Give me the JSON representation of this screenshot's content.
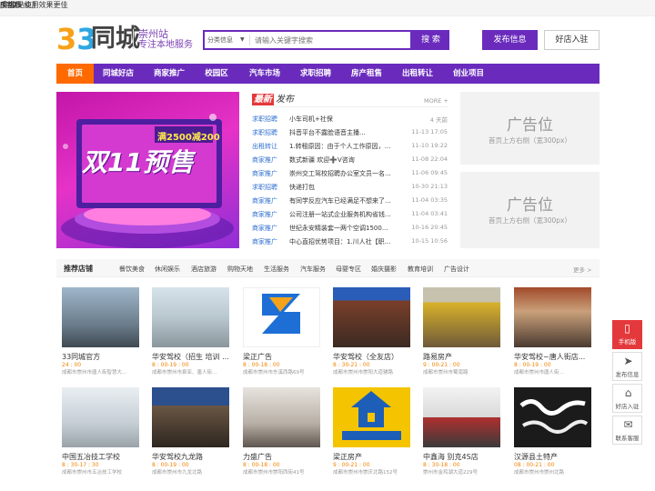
{
  "topbar": {
    "city": "成都市",
    "switch": "[切换站点]",
    "right": "手机版 使用效果更佳"
  },
  "header": {
    "logo_num": "33",
    "logo_text": "同城",
    "site_name": "崇州站",
    "slogan": "专注本地服务",
    "search_category": "分类信息",
    "search_placeholder": "请输入关键字搜索",
    "search_button": "搜 索",
    "post_button": "发布信息",
    "shop_button": "好店入驻"
  },
  "nav": [
    "首页",
    "同城好店",
    "商家推广",
    "校园区",
    "汽车市场",
    "求职招聘",
    "房产租售",
    "出租转让",
    "创业项目"
  ],
  "banner": {
    "line1": "双11预售",
    "badge": "满2500减200"
  },
  "news": {
    "tag": "最新",
    "title": "发布",
    "more": "MORE +",
    "items": [
      {
        "cat": "求职招聘",
        "text": "小车司机+社保",
        "time": "4 天前"
      },
      {
        "cat": "求职招聘",
        "text": "抖音平台不露脸语音主播...",
        "time": "11-13 17:05"
      },
      {
        "cat": "出租转让",
        "text": "1.转租原因：由于个人工作原因，...",
        "time": "11-10 19:22"
      },
      {
        "cat": "商家推广",
        "text": "数式新疆 欢迎➕V咨询",
        "time": "11-08 22:04"
      },
      {
        "cat": "商家推广",
        "text": "崇州交工驾校招聘办公室文员一名...",
        "time": "11-06 09:45"
      },
      {
        "cat": "求职招聘",
        "text": "快递打包",
        "time": "10-30 21:13"
      },
      {
        "cat": "商家推广",
        "text": "有同学反应汽车已经满足不想来了...",
        "time": "11-04 03:35"
      },
      {
        "cat": "商家推广",
        "text": "公司注册一站式企业服务机构省钱...",
        "time": "11-04 03:41"
      },
      {
        "cat": "商家推广",
        "text": "世纪永安精装套一两个空调1500...",
        "time": "10-16 20:45"
      },
      {
        "cat": "商家推广",
        "text": "中心直招优势项目：1.川人社【职...",
        "time": "10-15 10:56"
      }
    ]
  },
  "ads": [
    {
      "title": "广告位",
      "sub": "首页上方右侧（宽300px）"
    },
    {
      "title": "广告位",
      "sub": "首页上方右侧（宽300px）"
    }
  ],
  "shops": {
    "title": "推荐店铺",
    "more": "更多 >",
    "categories": [
      "餐饮美食",
      "休闲娱乐",
      "酒店旅游",
      "购物天地",
      "生活服务",
      "汽车服务",
      "母婴专区",
      "婚庆摄影",
      "教育培训",
      "广告设计"
    ],
    "row1": [
      {
        "name": "33同城官方",
        "time": "24 : 00",
        "addr": "成都市崇州市唐人街智慧大..."
      },
      {
        "name": "华安驾校（招生 培训 ...",
        "time": "8 : 00-19 : 00",
        "addr": "成都市崇州市泉亚、唐人街..."
      },
      {
        "name": "梁正广告",
        "time": "8 : 00-18 : 00",
        "addr": "成都市崇州市东溪西路69号"
      },
      {
        "name": "华安驾校（全友店）",
        "time": "8 : 30-21 : 00",
        "addr": "成都市崇州市崇阳大道辅路"
      },
      {
        "name": "路易房产",
        "time": "9 : 00-21 : 00",
        "addr": "成都市崇州市蜀南路"
      },
      {
        "name": "华安驾校~唐人街店...",
        "time": "8 : 00-19 : 00",
        "addr": "成都市崇州市唐人街..."
      }
    ],
    "row2": [
      {
        "name": "中国五冶技工学校",
        "time": "8 : 30-17 : 30",
        "addr": "成都市崇州市五冶技工学校"
      },
      {
        "name": "华安驾校九龙路",
        "time": "8 : 00-19 : 00",
        "addr": "成都市崇州市九龙北路"
      },
      {
        "name": "力盛广告",
        "time": "8 : 00-18 : 00",
        "addr": "成都市崇州市崇阳西街41号"
      },
      {
        "name": "梁正房产",
        "time": "9 : 00-21 : 00",
        "addr": "成都市崇州市崇庆北路152号"
      },
      {
        "name": "中鑫海 别克4S店",
        "time": "8 : 30-18 : 00",
        "addr": "崇州市金鸡湖大道229号"
      },
      {
        "name": "汉源县土特产",
        "time": "08 : 00-21 : 00",
        "addr": "成都市崇州市崇州北路"
      }
    ]
  },
  "sidebar": [
    {
      "label": "手机版",
      "icon": "mobile-icon"
    },
    {
      "label": "发布信息",
      "icon": "send-icon"
    },
    {
      "label": "好店入驻",
      "icon": "shop-icon"
    },
    {
      "label": "联系客服",
      "icon": "chat-icon"
    }
  ],
  "colors": {
    "brand": "#6a2bbd",
    "accent": "#ff6a00",
    "link": "#2e6fd0"
  }
}
